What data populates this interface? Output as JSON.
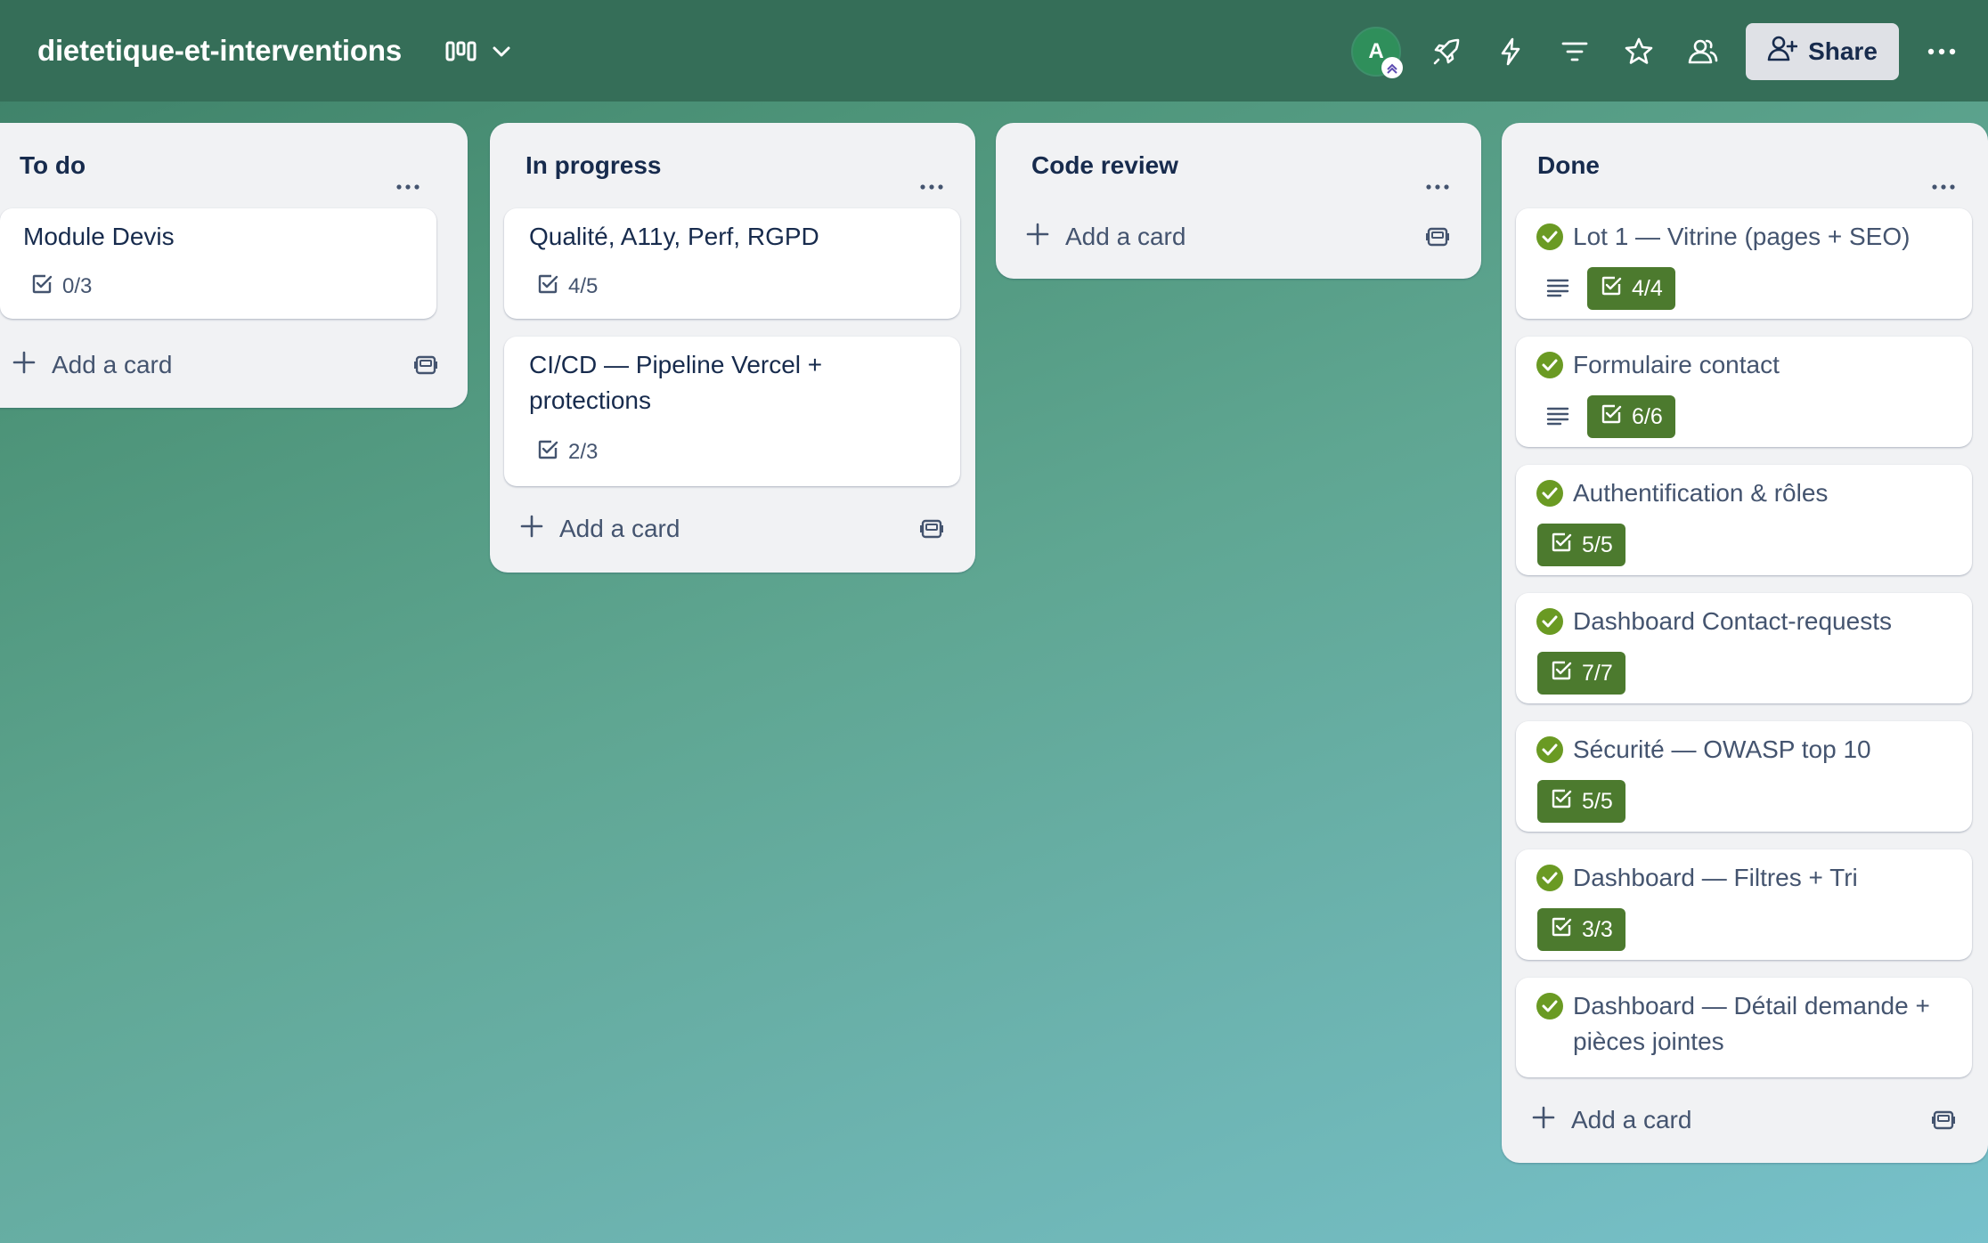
{
  "board": {
    "title": "dietetique-et-interventions",
    "avatar_initial": "A",
    "share_label": "Share"
  },
  "colors": {
    "header": "#356e58",
    "list_bg": "#f1f2f4",
    "checklist_complete": "#4c7a2e",
    "done_check": "#6a9a23"
  },
  "header_icons": [
    "board-view-icon",
    "chevron-down-icon",
    "rocket-icon",
    "lightning-icon",
    "filter-icon",
    "star-icon",
    "members-icon",
    "more-icon"
  ],
  "lists": [
    {
      "title": "To do",
      "add_label": "Add a card",
      "cards": [
        {
          "title": "Module Devis",
          "checklist": "0/3"
        }
      ]
    },
    {
      "title": "In progress",
      "add_label": "Add a card",
      "cards": [
        {
          "title": "Qualité, A11y, Perf, RGPD",
          "checklist": "4/5"
        },
        {
          "title_line1": "CI/CD — Pipeline Vercel +",
          "title_line2": "protections",
          "checklist": "2/3"
        }
      ]
    },
    {
      "title": "Code review",
      "add_label": "Add a card",
      "cards": []
    },
    {
      "title": "Done",
      "add_label": "Add a card",
      "cards": [
        {
          "title": "Lot 1 — Vitrine (pages + SEO)",
          "checklist": "4/4",
          "has_description": true
        },
        {
          "title": "Formulaire contact",
          "checklist": "6/6",
          "has_description": true
        },
        {
          "title": "Authentification & rôles",
          "checklist": "5/5"
        },
        {
          "title": "Dashboard Contact-requests",
          "checklist": "7/7"
        },
        {
          "title": "Sécurité — OWASP top 10",
          "checklist": "5/5"
        },
        {
          "title": "Dashboard — Filtres + Tri",
          "checklist": "3/3"
        },
        {
          "title_line1": "Dashboard — Détail demande +",
          "title_line2": "pièces jointes"
        }
      ]
    }
  ]
}
